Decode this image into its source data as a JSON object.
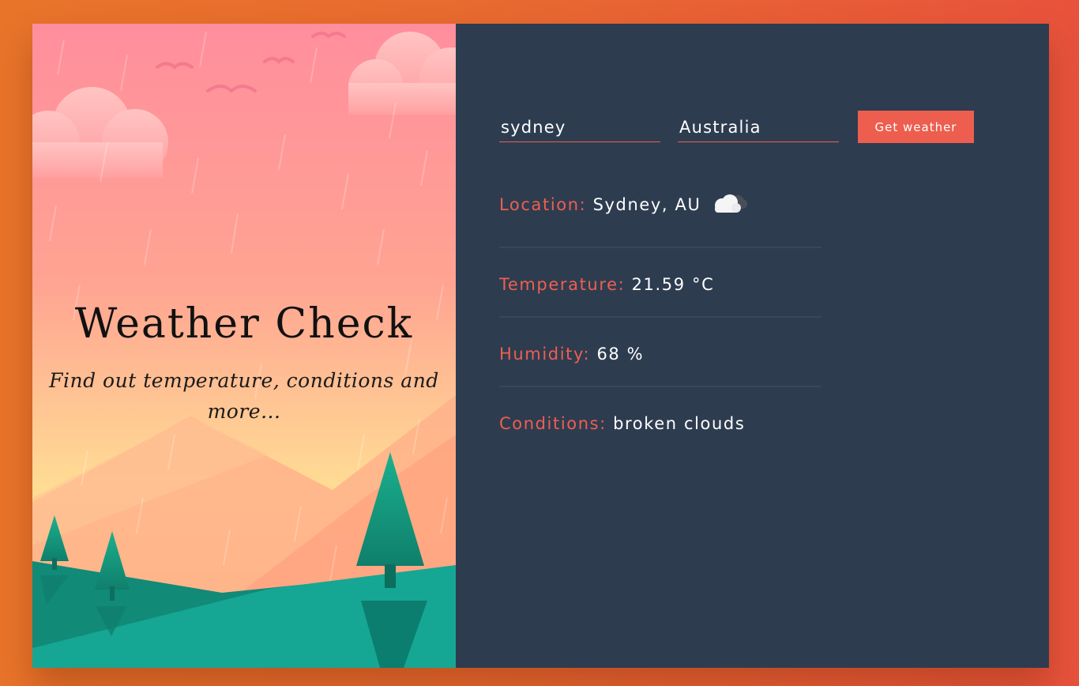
{
  "hero": {
    "title": "Weather Check",
    "subtitle": "Find out temperature, conditions and more..."
  },
  "form": {
    "city_value": "sydney",
    "country_value": "Australia",
    "submit_label": "Get weather"
  },
  "results": {
    "location_label": "Location:",
    "location_value": "Sydney, AU",
    "location_icon": "cloud-icon",
    "temperature_label": "Temperature:",
    "temperature_value": "21.59 °C",
    "humidity_label": "Humidity:",
    "humidity_value": "68 %",
    "conditions_label": "Conditions:",
    "conditions_value": "broken clouds"
  },
  "colors": {
    "accent": "#ee5f4f",
    "panel_background": "#2e3c50",
    "page_gradient_start": "#e8742a",
    "page_gradient_end": "#e8523c"
  }
}
